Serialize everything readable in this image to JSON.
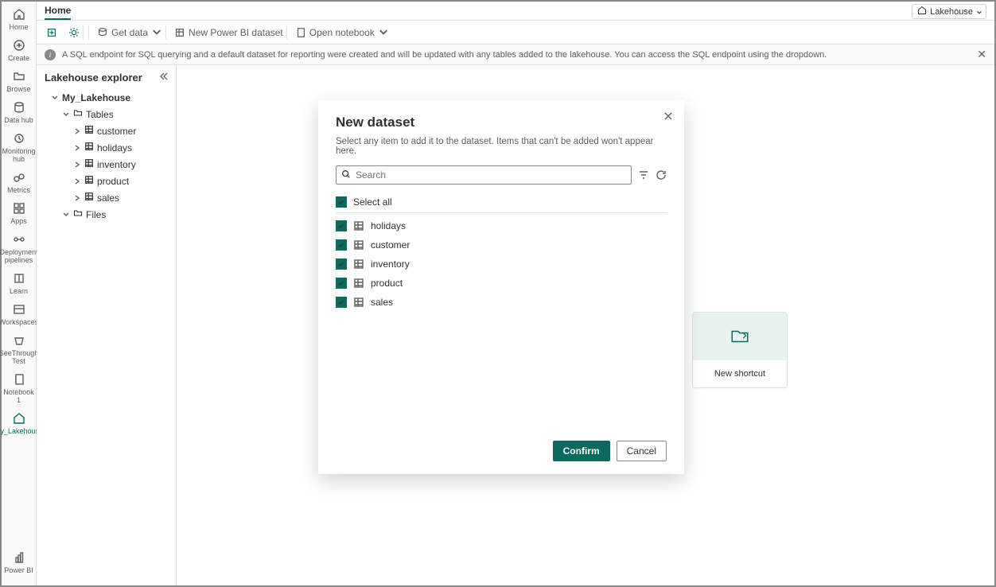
{
  "header": {
    "title": "Home",
    "view_switch": "Lakehouse"
  },
  "toolbar": {
    "get_data": "Get data",
    "new_dataset": "New Power BI dataset",
    "open_notebook": "Open notebook"
  },
  "infobar": {
    "message": "A SQL endpoint for SQL querying and a default dataset for reporting were created and will be updated with any tables added to the lakehouse. You can access the SQL endpoint using the dropdown."
  },
  "rail": [
    {
      "label": "Home"
    },
    {
      "label": "Create"
    },
    {
      "label": "Browse"
    },
    {
      "label": "Data hub"
    },
    {
      "label": "Monitoring hub"
    },
    {
      "label": "Metrics"
    },
    {
      "label": "Apps"
    },
    {
      "label": "Deployment pipelines"
    },
    {
      "label": "Learn"
    },
    {
      "label": "Workspaces"
    },
    {
      "label": "SeeThrough Test"
    },
    {
      "label": "Notebook 1"
    },
    {
      "label": "My_Lakehouse"
    }
  ],
  "rail_bottom": {
    "label": "Power BI"
  },
  "explorer": {
    "title": "Lakehouse explorer",
    "root": "My_Lakehouse",
    "tables_label": "Tables",
    "files_label": "Files",
    "tables": [
      "customer",
      "holidays",
      "inventory",
      "product",
      "sales"
    ]
  },
  "card": {
    "label": "New shortcut"
  },
  "modal": {
    "title": "New dataset",
    "subtitle": "Select any item to add it to the dataset. Items that can't be added won't appear here.",
    "search_placeholder": "Search",
    "select_all": "Select all",
    "items": [
      "holidays",
      "customer",
      "inventory",
      "product",
      "sales"
    ],
    "confirm": "Confirm",
    "cancel": "Cancel"
  }
}
